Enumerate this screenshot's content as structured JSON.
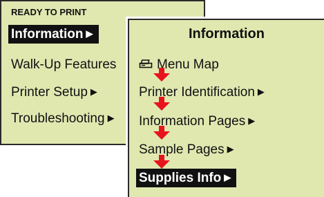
{
  "status": {
    "text": "READY TO PRINT"
  },
  "left_menu": {
    "items": [
      {
        "label": "Information",
        "arrow": "▶",
        "selected": true
      },
      {
        "label": "Walk-Up Features",
        "arrow": "",
        "selected": false
      },
      {
        "label": "Printer Setup",
        "arrow": "▶",
        "selected": false
      },
      {
        "label": "Troubleshooting",
        "arrow": "▶",
        "selected": false
      }
    ]
  },
  "right_menu": {
    "title": "Information",
    "items": [
      {
        "label": "Menu Map",
        "icon": "printer-icon",
        "arrow": "",
        "selected": false
      },
      {
        "label": "Printer Identification",
        "arrow": "▶",
        "selected": false
      },
      {
        "label": "Information Pages",
        "arrow": "▶",
        "selected": false
      },
      {
        "label": "Sample Pages",
        "arrow": "▶",
        "selected": false
      },
      {
        "label": "Supplies Info",
        "arrow": "▶",
        "selected": true
      }
    ]
  },
  "colors": {
    "panel_bg": "#e0e8b0",
    "border": "#2a2a2a",
    "highlight_bg": "#111111",
    "arrow_red": "#e8141c"
  }
}
